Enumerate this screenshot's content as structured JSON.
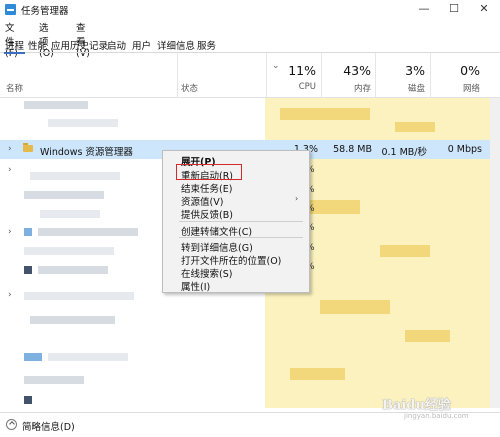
{
  "window": {
    "title": "任务管理器",
    "minimize": "—",
    "maximize": "☐",
    "close": "✕"
  },
  "menu": [
    {
      "label": "文件(F)"
    },
    {
      "label": "选项(O)"
    },
    {
      "label": "查看(V)"
    }
  ],
  "tabs": [
    {
      "label": "进程",
      "active": true
    },
    {
      "label": "性能"
    },
    {
      "label": "应用历史记录"
    },
    {
      "label": "启动"
    },
    {
      "label": "用户"
    },
    {
      "label": "详细信息"
    },
    {
      "label": "服务"
    }
  ],
  "columns": {
    "name": "名称",
    "status": "状态",
    "cpu": {
      "percent": "11%",
      "label": "CPU"
    },
    "memory": {
      "percent": "43%",
      "label": "内存"
    },
    "disk": {
      "percent": "3%",
      "label": "磁盘"
    },
    "network": {
      "percent": "0%",
      "label": "网络"
    }
  },
  "selected_row": {
    "name": "Windows 资源管理器",
    "cpu": "1.3%",
    "memory": "58.8 MB",
    "disk": "0.1 MB/秒",
    "network": "0 Mbps"
  },
  "context_menu": [
    {
      "label": "展开(P)",
      "bold": true
    },
    {
      "label": "重新启动(R)",
      "highlighted": true
    },
    {
      "label": "结束任务(E)"
    },
    {
      "label": "资源值(V)",
      "submenu": true
    },
    {
      "label": "提供反馈(B)"
    },
    {
      "label": "创建转储文件(C)"
    },
    {
      "label": "转到详细信息(G)"
    },
    {
      "label": "打开文件所在的位置(O)"
    },
    {
      "label": "在线搜索(S)"
    },
    {
      "label": "属性(I)"
    }
  ],
  "visible_percent_marks": [
    "%",
    "%",
    "%",
    "%",
    "%",
    "%"
  ],
  "footer": {
    "label": "简略信息(D)"
  },
  "watermark": {
    "brand": "Baidu经验",
    "sub": "jingyan.baidu.com"
  },
  "colors": {
    "selection": "#cde6fb",
    "heat": "#fbf2bf",
    "highlight_box": "#d12a2a",
    "tab_underline": "#3c6fbf"
  }
}
